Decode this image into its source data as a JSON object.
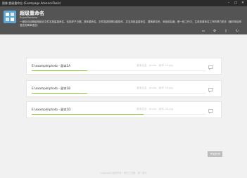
{
  "window": {
    "title": "图像 超级重命名 (Exampage AdvanceTools)",
    "min_icon": "minimize-icon",
    "max_icon": "maximize-icon",
    "close_icon": "close-icon"
  },
  "header": {
    "title": "超级重命名",
    "subtitle": "SuperRename",
    "description": "一键全自动超级相组合文件名批量重命名。包括样子日期、按序重命名。文件描述按照功能操作，并支持批量重命名、替换新名称、添加前后缀，是一批工作中，生成参重命名工作的得力助手（最好用自然语言的简单语言）",
    "tools": [
      {
        "icon": "folder-icon"
      },
      {
        "icon": "settings-icon"
      },
      {
        "icon": "trash-icon"
      },
      {
        "icon": "refresh-icon"
      }
    ],
    "accent": "#545454"
  },
  "files": [
    {
      "name": "E:\\example\\photo - 副本1A",
      "status": "重命名至：photo - 副本 1A.jpg",
      "progress": 0.32
    },
    {
      "name": "E:\\example\\photo - 副本1B",
      "status": "重命名至：photo - 副本 1B.jpg",
      "progress": 0.32
    },
    {
      "name": "E:\\example\\photo - 副本1D",
      "status": "重命名至：photo - 副本 1D.jpg",
      "progress": 0.64
    }
  ],
  "actions": {
    "start_label": "开始处理"
  },
  "footer": {
    "text": "Copyright 版权所有 · 软件工具集 · 第一版本"
  },
  "colors": {
    "progress": "#8cc63f",
    "card_bg": "#ffffff",
    "page_bg": "#f1f1f1"
  }
}
